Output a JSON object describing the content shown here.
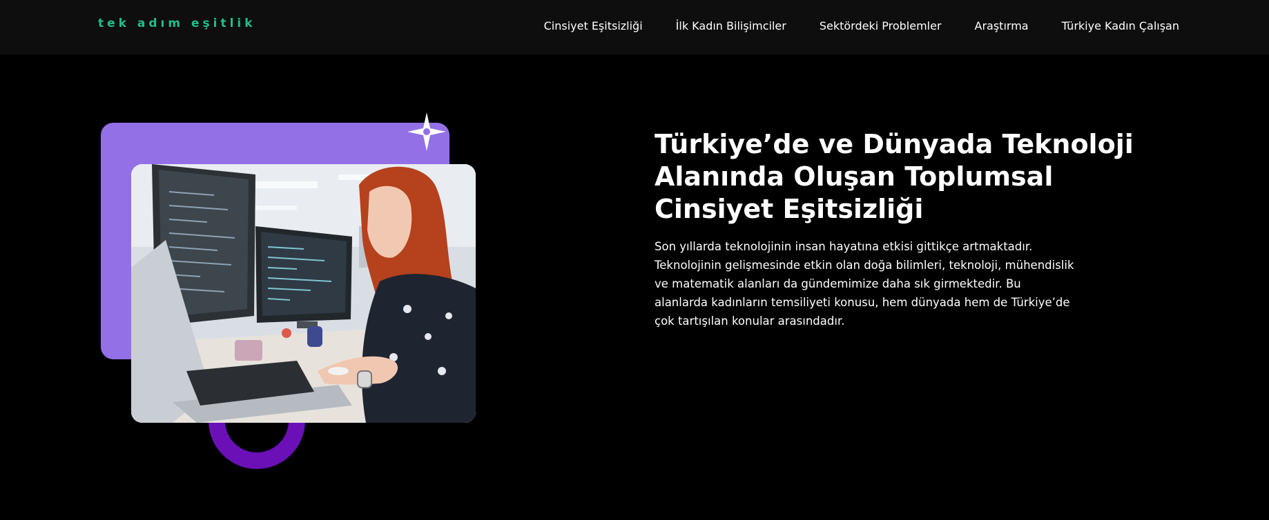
{
  "header": {
    "logo": "tek adım eşitlik",
    "nav": [
      {
        "label": "Cinsiyet Eşitsizliği"
      },
      {
        "label": "İlk Kadın Bilişimciler"
      },
      {
        "label": "Sektördeki Problemler"
      },
      {
        "label": "Araştırma"
      },
      {
        "label": "Türkiye Kadın Çalışan"
      }
    ]
  },
  "hero": {
    "title": "Türkiye’de ve Dünyada Teknoloji Alanında Oluşan Toplumsal Cinsiyet Eşitsizliği",
    "description": "Son yıllarda teknolojinin insan hayatına etkisi gittikçe artmaktadır. Teknolojinin gelişmesinde etkin olan doğa bilimleri, teknoloji, mühendislik ve matematik alanları da gündemimize daha sık girmektedir. Bu alanlarda kadınların temsiliyeti konusu, hem dünyada hem de Türkiye’de çok tartışılan konular arasındadır."
  },
  "colors": {
    "accent_green": "#1fbf86",
    "purple_panel": "#9370e6",
    "ring": "#6a10b6",
    "background": "#000000",
    "nav_background": "#0e0e0e"
  },
  "icons": {
    "decoration": "sparkle-icon"
  }
}
